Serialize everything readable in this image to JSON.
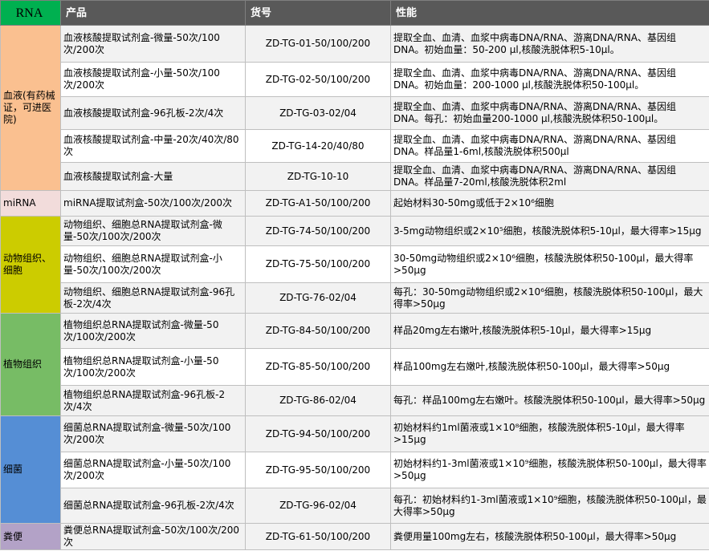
{
  "header": {
    "category": "RNA",
    "product": "产品",
    "code": "货号",
    "performance": "性能"
  },
  "colors": {
    "header_bg": "#595959",
    "rna_header_bg": "#00b050",
    "row_shade": "#f2f2f2"
  },
  "groups": [
    {
      "category": "血液(有药械证，可进医院)",
      "color": "#fac090",
      "rows": [
        {
          "product": "血液核酸提取试剂盒-微量-50次/100次/200次",
          "code": "ZD-TG-01-50/100/200",
          "performance": "提取全血、血清、血浆中病毒DNA/RNA、游离DNA/RNA、基因组DNA。初始血量：50-200 µl,核酸洗脱体积5-10µl。"
        },
        {
          "product": "血液核酸提取试剂盒-小量-50次/100次/200次",
          "code": "ZD-TG-02-50/100/200",
          "performance": "提取全血、血清、血浆中病毒DNA/RNA、游离DNA/RNA、基因组DNA。初始血量：200-1000 µl,核酸洗脱体积50-100µl。"
        },
        {
          "product": "血液核酸提取试剂盒-96孔板-2次/4次",
          "code": "ZD-TG-03-02/04",
          "performance": "提取全血、血清、血浆中病毒DNA/RNA、游离DNA/RNA、基因组DNA。每孔：初始血量200-1000 µl,核酸洗脱体积50-100µl。"
        },
        {
          "product": "血液核酸提取试剂盒-中量-20次/40次/80次",
          "code": "ZD-TG-14-20/40/80",
          "performance": "提取全血、血清、血浆中病毒DNA/RNA、游离DNA/RNA、基因组DNA。样品量1-6ml,核酸洗脱体积500µl"
        },
        {
          "product": "血液核酸提取试剂盒-大量",
          "code": "ZD-TG-10-10",
          "performance": "提取全血、血清、血浆中病毒DNA/RNA、游离DNA/RNA、基因组DNA。样品量7-20ml,核酸洗脱体积2ml"
        }
      ]
    },
    {
      "category": "miRNA",
      "color": "#f2dcdb",
      "rows": [
        {
          "product": "miRNA提取试剂盒-50次/100次/200次",
          "code": "ZD-TG-A1-50/100/200",
          "performance": "起始材料30-50mg或低于2×10⁶细胞"
        }
      ]
    },
    {
      "category": "动物组织、细胞",
      "color": "#cccc00",
      "rows": [
        {
          "product": "动物组织、细胞总RNA提取试剂盒-微量-50次/100次/200次",
          "code": "ZD-TG-74-50/100/200",
          "performance": "3-5mg动物组织或2×10⁵细胞，核酸洗脱体积5-10µl，最大得率>15µg"
        },
        {
          "product": "动物组织、细胞总RNA提取试剂盒-小量-50次/100次/200次",
          "code": "ZD-TG-75-50/100/200",
          "performance": "30-50mg动物组织或2×10⁶细胞，核酸洗脱体积50-100µl，最大得率>50µg"
        },
        {
          "product": "动物组织、细胞总RNA提取试剂盒-96孔板-2次/4次",
          "code": "ZD-TG-76-02/04",
          "performance": "每孔：30-50mg动物组织或2×10⁶细胞，核酸洗脱体积50-100µl，最大得率>50µg"
        }
      ]
    },
    {
      "category": "植物组织",
      "color": "#77bc65",
      "rows": [
        {
          "product": "植物组织总RNA提取试剂盒-微量-50次/100次/200次",
          "code": "ZD-TG-84-50/100/200",
          "performance": "样品20mg左右嫩叶,核酸洗脱体积5-10µl，最大得率>15µg"
        },
        {
          "product": "植物组织总RNA提取试剂盒-小量-50次/100次/200次",
          "code": "ZD-TG-85-50/100/200",
          "performance": "样品100mg左右嫩叶,核酸洗脱体积50-100µl，最大得率>50µg"
        },
        {
          "product": "植物组织总RNA提取试剂盒-96孔板-2次/4次",
          "code": "ZD-TG-86-02/04",
          "performance": "每孔：样品100mg左右嫩叶。核酸洗脱体积50-100µl，最大得率>50µg"
        }
      ]
    },
    {
      "category": "细菌",
      "color": "#558ed5",
      "rows": [
        {
          "product": "细菌总RNA提取试剂盒-微量-50次/100次/200次",
          "code": "ZD-TG-94-50/100/200",
          "performance": "初始材料约1ml菌液或1×10⁸细胞，核酸洗脱体积5-10µl，最大得率>15µg"
        },
        {
          "product": "细菌总RNA提取试剂盒-小量-50次/100次/200次",
          "code": "ZD-TG-95-50/100/200",
          "performance": "初始材料约1-3ml菌液或1×10⁹细胞，核酸洗脱体积50-100µl，最大得率>50µg"
        },
        {
          "product": "细菌总RNA提取试剂盒-96孔板-2次/4次",
          "code": "ZD-TG-96-02/04",
          "performance": "每孔：初始材料约1-3ml菌液或1×10⁹细胞，核酸洗脱体积50-100µl，最大得率>50µg"
        }
      ]
    },
    {
      "category": "粪便",
      "color": "#b3a2c7",
      "rows": [
        {
          "product": "粪便总RNA提取试剂盒-50次/100次/200次",
          "code": "ZD-TG-61-50/100/200",
          "performance": "粪便用量100mg左右，核酸洗脱体积50-100µl，最大得率>50µg"
        }
      ]
    }
  ]
}
